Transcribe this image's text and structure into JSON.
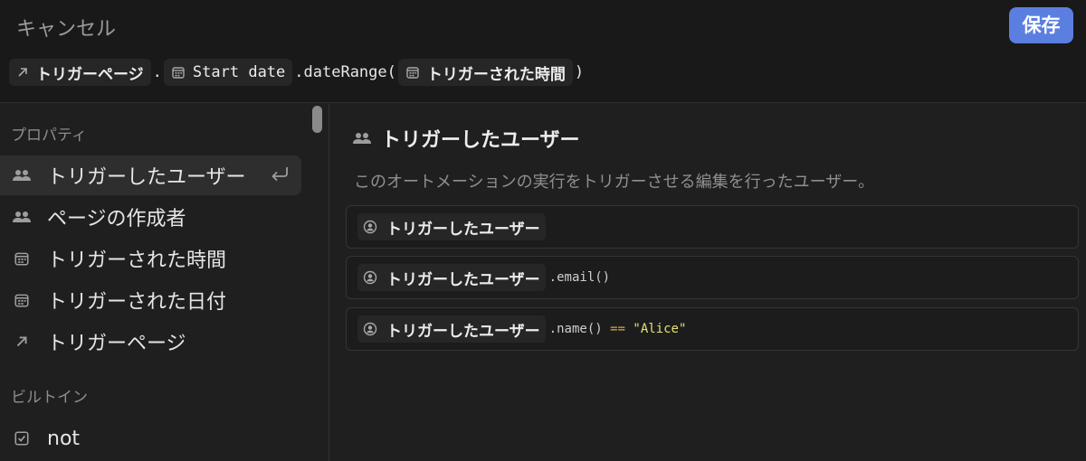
{
  "header": {
    "cancel_label": "キャンセル",
    "save_label": "保存"
  },
  "formula": {
    "page_chip": "トリガーページ",
    "dot1": ".",
    "start_date_chip": "Start date",
    "method": ".dateRange(",
    "time_chip": "トリガーされた時間",
    "close_paren": ")"
  },
  "sidebar": {
    "properties_label": "プロパティ",
    "items": [
      {
        "label": "トリガーしたユーザー",
        "icon": "people-icon"
      },
      {
        "label": "ページの作成者",
        "icon": "people-icon"
      },
      {
        "label": "トリガーされた時間",
        "icon": "calendar-icon"
      },
      {
        "label": "トリガーされた日付",
        "icon": "calendar-icon"
      },
      {
        "label": "トリガーページ",
        "icon": "arrow-up-right-icon"
      }
    ],
    "builtins_label": "ビルトイン",
    "builtins": [
      {
        "label": "not",
        "icon": "checkbox-icon"
      }
    ]
  },
  "detail": {
    "title": "トリガーしたユーザー",
    "description": "このオートメーションの実行をトリガーさせる編集を行ったユーザー。",
    "examples": [
      {
        "chip": "トリガーしたユーザー",
        "suffix": "",
        "op": "",
        "str": ""
      },
      {
        "chip": "トリガーしたユーザー",
        "suffix": ".email()",
        "op": "",
        "str": ""
      },
      {
        "chip": "トリガーしたユーザー",
        "suffix": ".name() ",
        "op": "==",
        "str": " \"Alice\""
      }
    ]
  },
  "colors": {
    "accent": "#5a7fe0",
    "operator": "#d6a64a",
    "string": "#e4e075"
  }
}
